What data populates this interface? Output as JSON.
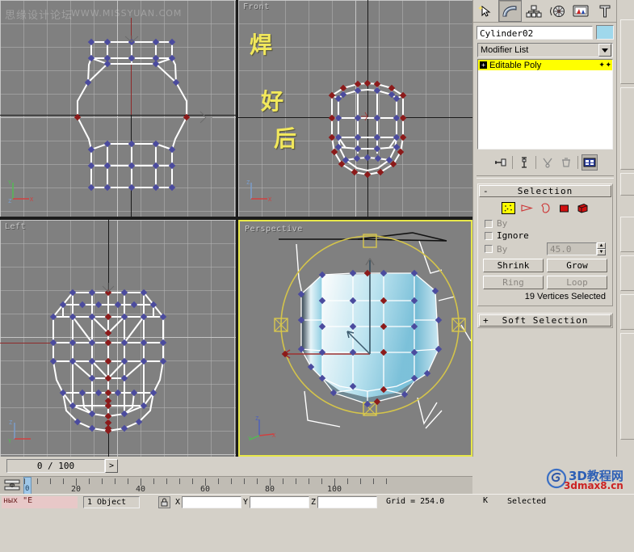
{
  "app": {
    "name": "3ds Max",
    "bg_color": "#d4d0c8",
    "viewport_color": "#808080"
  },
  "watermark": {
    "line1": "思缘设计论坛",
    "line2": "WWW.MISSYUAN.COM"
  },
  "viewports": [
    {
      "id": "top",
      "label": "",
      "active": false
    },
    {
      "id": "front",
      "label": "Front",
      "active": false
    },
    {
      "id": "left",
      "label": "Left",
      "active": false
    },
    {
      "id": "perspective",
      "label": "Perspective",
      "active": true
    }
  ],
  "annotation": {
    "chars": [
      "焊",
      "好",
      "后"
    ],
    "color": "#f2e85c"
  },
  "command_panel": {
    "tabs": [
      {
        "name": "create-tab",
        "icon": "arrow-star-icon",
        "selected": false
      },
      {
        "name": "modify-tab",
        "icon": "bent-tube-icon",
        "selected": true
      },
      {
        "name": "hierarchy-tab",
        "icon": "hierarchy-icon",
        "selected": false
      },
      {
        "name": "motion-tab",
        "icon": "wheel-icon",
        "selected": false
      },
      {
        "name": "display-tab",
        "icon": "monitor-icon",
        "selected": false
      },
      {
        "name": "utilities-tab",
        "icon": "hammer-icon",
        "selected": false
      }
    ],
    "object_name": "Cylinder02",
    "object_color": "#9fd8ec",
    "modifier_list_label": "Modifier List",
    "stack": [
      {
        "label": "Editable Poly",
        "selected": true,
        "expandable": "+"
      }
    ],
    "stack_buttons": [
      {
        "name": "pin-stack-button",
        "icon": "pin-icon"
      },
      {
        "name": "show-end-result-button",
        "icon": "flask-icon"
      },
      {
        "name": "make-unique-button",
        "icon": "diamond-icon"
      },
      {
        "name": "remove-modifier-button",
        "icon": "trash-icon"
      },
      {
        "name": "configure-sets-button",
        "icon": "configure-icon",
        "active": true
      }
    ],
    "rollouts": [
      {
        "id": "selection",
        "title": "Selection",
        "expanded": true,
        "toggle": "-",
        "sub_objects": [
          {
            "name": "vertex-subobject",
            "icon": "vertex-icon",
            "selected": true
          },
          {
            "name": "edge-subobject",
            "icon": "edge-icon",
            "selected": false
          },
          {
            "name": "border-subobject",
            "icon": "border-icon",
            "selected": false
          },
          {
            "name": "polygon-subobject",
            "icon": "polygon-icon",
            "selected": false
          },
          {
            "name": "element-subobject",
            "icon": "element-icon",
            "selected": false
          }
        ],
        "checkboxes": [
          {
            "label": "By",
            "checked": false,
            "enabled": false
          },
          {
            "label": "Ignore",
            "checked": false,
            "enabled": true
          },
          {
            "label": "By",
            "checked": false,
            "enabled": false
          }
        ],
        "angle_value": "45.0",
        "buttons": [
          {
            "label": "Shrink",
            "enabled": true
          },
          {
            "label": "Grow",
            "enabled": true
          },
          {
            "label": "Ring",
            "enabled": false
          },
          {
            "label": "Loop",
            "enabled": false
          }
        ],
        "status": "19 Vertices Selected"
      },
      {
        "id": "soft-selection",
        "title": "Soft Selection",
        "expanded": false,
        "toggle": "+"
      }
    ]
  },
  "timeline": {
    "frame_readout": "0 / 100",
    "next_frame_label": ">",
    "current_frame": "0",
    "tick_labels": [
      "20",
      "40",
      "60",
      "80",
      "100"
    ],
    "range_start": 0,
    "range_end": 100
  },
  "statusbar": {
    "prompt": "ных \"E",
    "object_count": "1 Object",
    "x_label": "X",
    "y_label": "Y",
    "z_label": "Z",
    "x_value": "",
    "y_value": "",
    "z_value": "",
    "grid_text": "Grid = 254.0",
    "add_time_tag": "K",
    "selection_text": "Selected"
  },
  "logo": {
    "top": "3D教程网",
    "bottom": "3dmax8.cn"
  }
}
